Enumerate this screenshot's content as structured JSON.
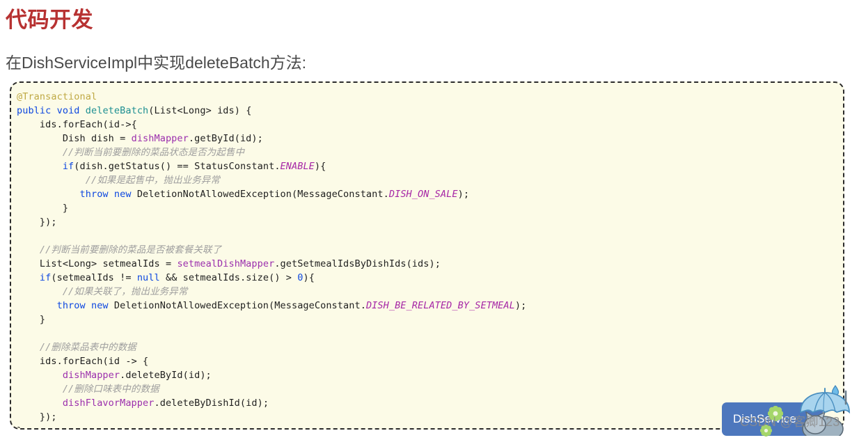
{
  "page": {
    "title": "代码开发",
    "subtitle": "在DishServiceImpl中实现deleteBatch方法:",
    "title_color": "#b73232",
    "subtitle_color": "#4a4a4a",
    "background": "#ffffff"
  },
  "code_block": {
    "background": "#fcfbe7",
    "border_color": "#2b2b2b",
    "language": "java",
    "lines": [
      "@Transactional",
      "public void deleteBatch(List<Long> ids) {",
      "    ids.forEach(id->{",
      "        Dish dish = dishMapper.getById(id);",
      "        //判断当前要删除的菜品状态是否为起售中",
      "        if(dish.getStatus() == StatusConstant.ENABLE){",
      "            //如果是起售中，抛出业务异常",
      "           throw new DeletionNotAllowedException(MessageConstant.DISH_ON_SALE);",
      "        }",
      "    });",
      "",
      "    //判断当前要删除的菜品是否被套餐关联了",
      "    List<Long> setmealIds = setmealDishMapper.getSetmealIdsByDishIds(ids);",
      "    if(setmealIds != null && setmealIds.size() > 0){",
      "        //如果关联了，抛出业务异常",
      "       throw new DeletionNotAllowedException(MessageConstant.DISH_BE_RELATED_BY_SETMEAL);",
      "    }",
      "",
      "    //删除菜品表中的数据",
      "    ids.forEach(id -> {",
      "        dishMapper.deleteById(id);",
      "        //删除口味表中的数据",
      "        dishFlavorMapper.deleteByDishId(id);",
      "    });",
      "}"
    ]
  },
  "tooltip": {
    "label": "DishService",
    "background": "#4d77bd",
    "text_color": "#ffffff"
  },
  "watermark": {
    "text": "CSDN @客卿123",
    "color": "#8c8c8c"
  },
  "syntax_colors": {
    "annotation": "#bfa944",
    "keyword": "#0d47e0",
    "method": "#1d8f92",
    "field": "#9b2fad",
    "constant": "#a626a6",
    "comment": "#9e9e9e",
    "plain": "#202020"
  }
}
